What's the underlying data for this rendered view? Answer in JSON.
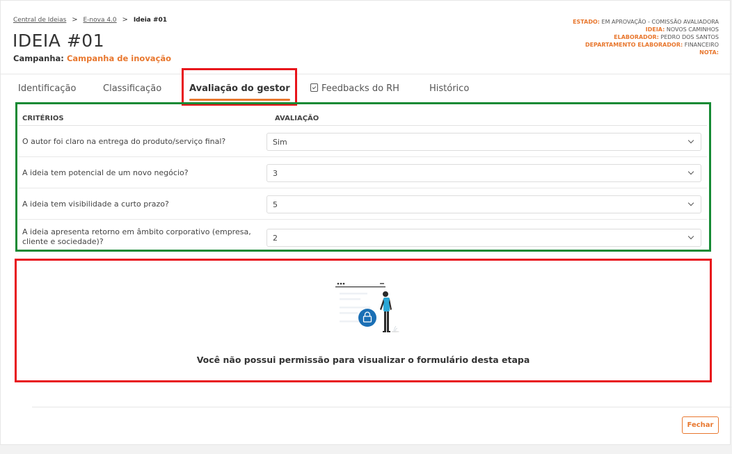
{
  "breadcrumb": {
    "items": [
      "Central de Ideias",
      "E-nova 4.0"
    ],
    "current": "Ideia #01",
    "separator": ">"
  },
  "page": {
    "title": "IDEIA #01",
    "campaign_label": "Campanha:",
    "campaign_value": "Campanha de inovação"
  },
  "meta": {
    "estado_label": "ESTADO:",
    "estado_value": "EM APROVAÇÃO - COMISSÃO AVALIADORA",
    "ideia_label": "IDEIA:",
    "ideia_value": "NOVOS CAMINHOS",
    "elaborador_label": "ELABORADOR:",
    "elaborador_value": "PEDRO DOS SANTOS",
    "depto_label": "DEPARTAMENTO ELABORADOR:",
    "depto_value": "FINANCEIRO",
    "nota_label": "NOTA:"
  },
  "tabs": [
    {
      "label": "Identificação"
    },
    {
      "label": "Classificação"
    },
    {
      "label": "Avaliação do gestor",
      "active": true
    },
    {
      "label": "Feedbacks do RH"
    },
    {
      "label": "Histórico"
    }
  ],
  "table": {
    "col_criteria": "CRITÉRIOS",
    "col_evaluation": "AVALIAÇÃO",
    "rows": [
      {
        "question": "O autor foi claro na entrega do produto/serviço final?",
        "value": "Sim"
      },
      {
        "question": "A ideia tem potencial de um novo negócio?",
        "value": "3"
      },
      {
        "question": "A ideia tem visibilidade a curto prazo?",
        "value": "5"
      },
      {
        "question": "A ideia apresenta retorno em âmbito corporativo (empresa, cliente e sociedade)?",
        "value": "2"
      }
    ]
  },
  "empty_state": {
    "message": "Você não possui permissão para visualizar o formulário desta etapa",
    "icon": "lock-icon"
  },
  "footer": {
    "close_label": "Fechar"
  },
  "colors": {
    "accent": "#e8772e",
    "highlight_red": "#e8141b",
    "highlight_green": "#168a34",
    "lock_blue": "#1a6fb5"
  }
}
